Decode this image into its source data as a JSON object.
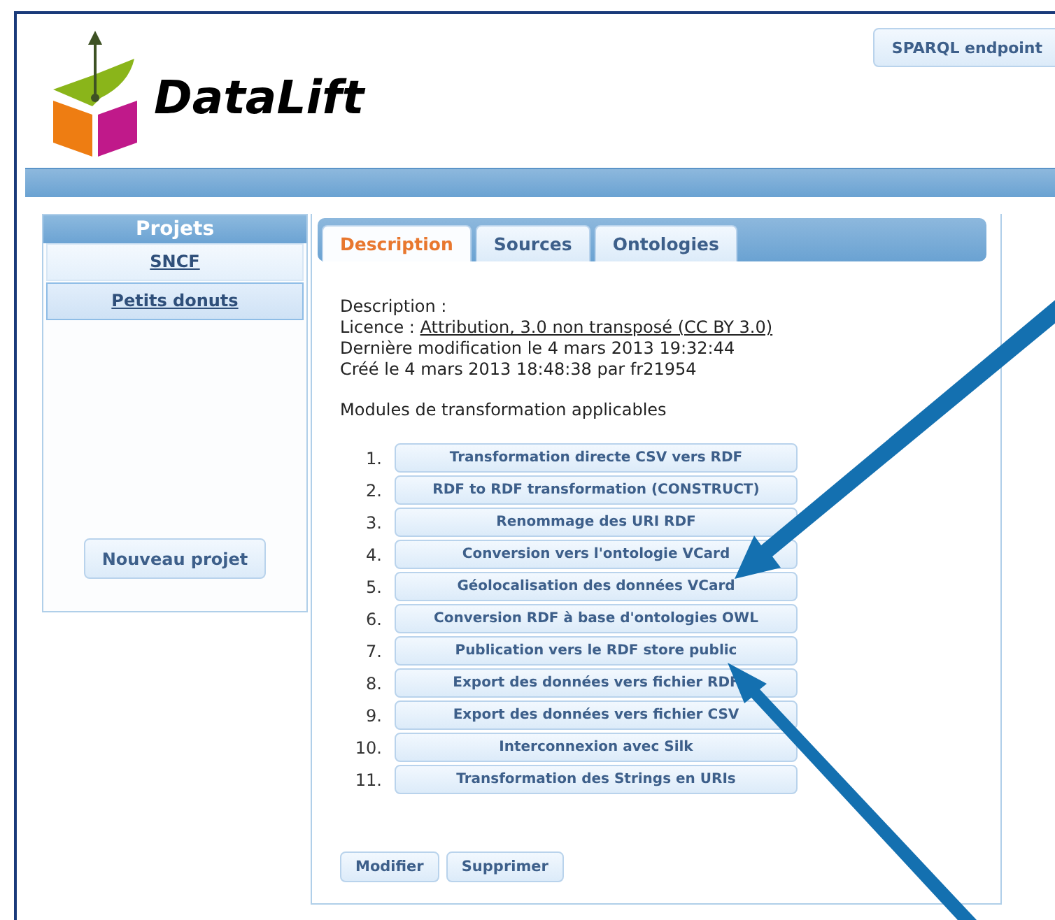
{
  "header": {
    "logo_text": "DataLift",
    "endpoint_button": "SPARQL endpoint"
  },
  "sidebar": {
    "title": "Projets",
    "projects": [
      {
        "name": "SNCF",
        "selected": false
      },
      {
        "name": "Petits donuts",
        "selected": true
      }
    ],
    "new_button": "Nouveau projet"
  },
  "tabs": [
    {
      "label": "Description",
      "selected": true
    },
    {
      "label": "Sources",
      "selected": false
    },
    {
      "label": "Ontologies",
      "selected": false
    }
  ],
  "description": {
    "label": "Description :",
    "licence_label": "Licence :",
    "licence_link": "Attribution, 3.0 non transposé (CC BY 3.0)",
    "modified": "Dernière modification le 4 mars 2013 19:32:44",
    "created": "Créé le 4 mars 2013 18:48:38 par fr21954"
  },
  "modules_title": "Modules de transformation applicables",
  "modules": [
    {
      "number": "1.",
      "label": "Transformation directe CSV vers RDF"
    },
    {
      "number": "2.",
      "label": "RDF to RDF transformation (CONSTRUCT)"
    },
    {
      "number": "3.",
      "label": "Renommage des URI RDF"
    },
    {
      "number": "4.",
      "label": "Conversion vers l'ontologie VCard"
    },
    {
      "number": "5.",
      "label": "Géolocalisation des données VCard"
    },
    {
      "number": "6.",
      "label": "Conversion RDF à base d'ontologies OWL"
    },
    {
      "number": "7.",
      "label": "Publication vers le RDF store public"
    },
    {
      "number": "8.",
      "label": "Export des données vers fichier RDF"
    },
    {
      "number": "9.",
      "label": "Export des données vers fichier CSV"
    },
    {
      "number": "10.",
      "label": "Interconnexion avec Silk"
    },
    {
      "number": "11.",
      "label": "Transformation des Strings en URIs"
    }
  ],
  "actions": [
    "Modifier",
    "Supprimer"
  ]
}
